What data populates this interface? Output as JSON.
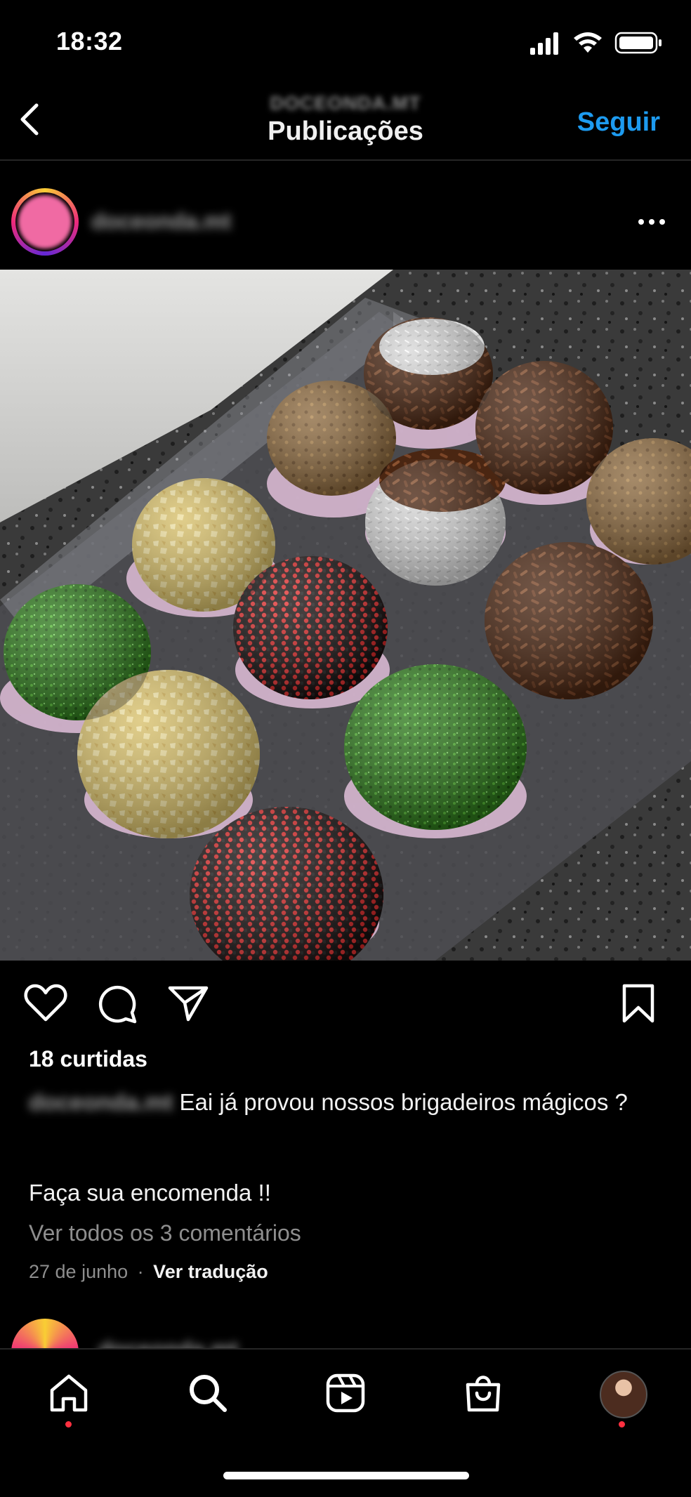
{
  "status_bar": {
    "time": "18:32"
  },
  "header": {
    "account_name": "DOCEONDA.MT",
    "title": "Publicações",
    "follow_label": "Seguir"
  },
  "post": {
    "username": "doceonda.mt",
    "likes": "18 curtidas",
    "caption_user": "doceonda.mt",
    "caption_text": "Eai já provou nossos brigadeiros mágicos ?",
    "caption_line2": "Faça sua encomenda !!",
    "view_comments": "Ver todos os 3 comentários",
    "date": "27 de junho",
    "separator": "·",
    "translate_label": "Ver tradução"
  },
  "next_post": {
    "username": "doceonda.mt"
  },
  "nav": {
    "items": [
      "home-icon",
      "search-icon",
      "reels-icon",
      "shop-icon",
      "profile-avatar"
    ]
  },
  "colors": {
    "accent": "#1d9bf0",
    "notification_dot": "#ff3040",
    "background": "#000000"
  }
}
